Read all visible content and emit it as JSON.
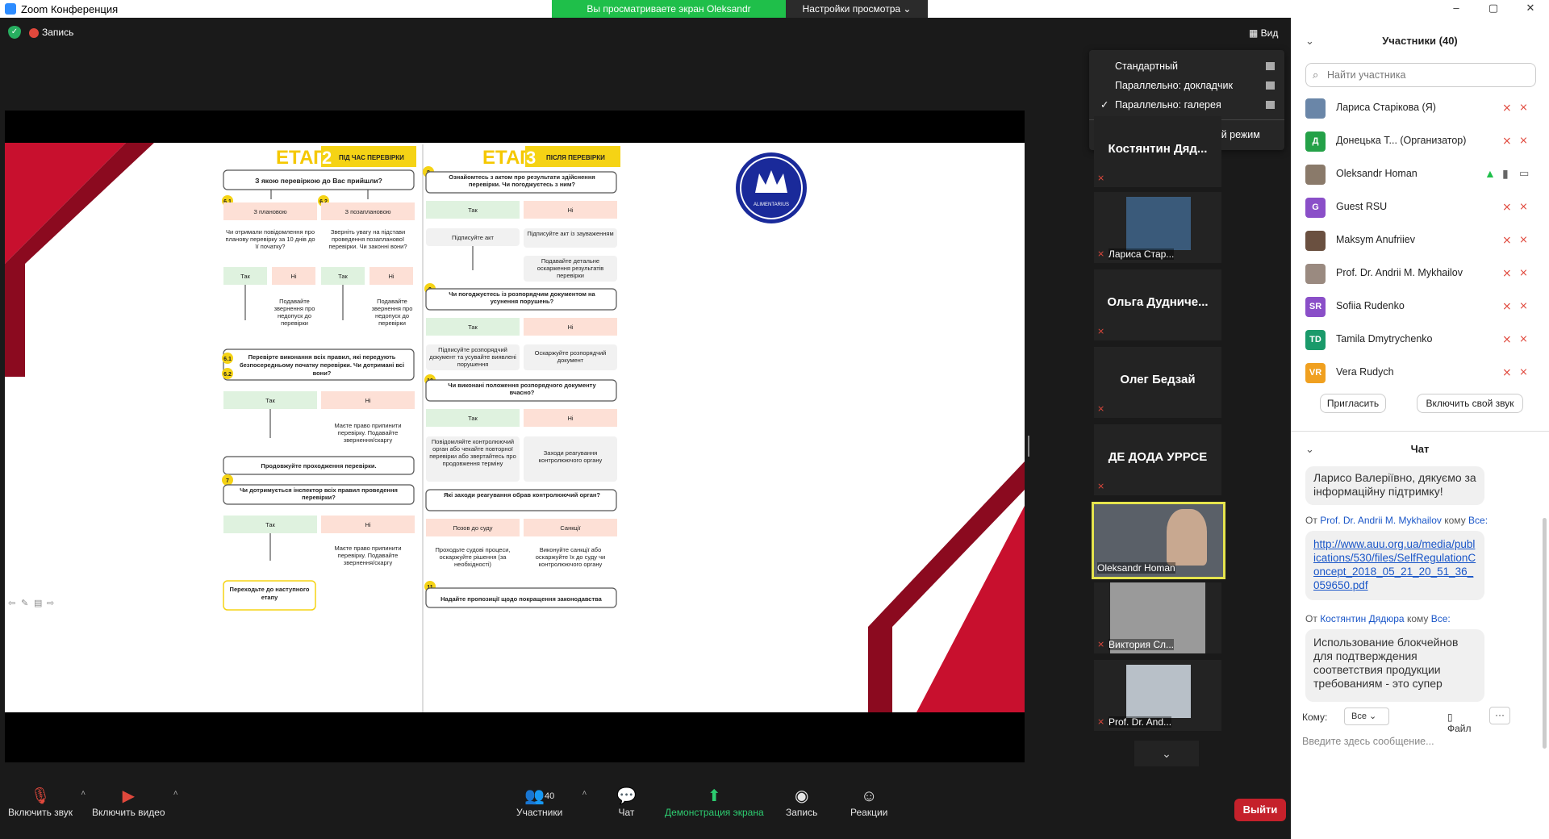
{
  "window": {
    "title": "Zoom Конференция",
    "minimize": "–",
    "maximize": "▢",
    "close": "✕"
  },
  "share_bar": {
    "viewing": "Вы просматриваете экран Oleksandr Homan",
    "view_options": "Настройки просмотра ⌄"
  },
  "top": {
    "record": "Запись",
    "view": "Вид"
  },
  "view_menu": {
    "items": [
      {
        "label": "Стандартный",
        "checked": false
      },
      {
        "label": "Параллельно: докладчик",
        "checked": false
      },
      {
        "label": "Параллельно: галерея",
        "checked": true
      }
    ],
    "check_glyph": "✓",
    "fullscreen": "Войти в полноэкранный режим"
  },
  "slide": {
    "stage2": {
      "word": "ЕТАП",
      "num": "2",
      "tag": "ПІД ЧАС ПЕРЕВІРКИ"
    },
    "stage3": {
      "word": "ЕТАП",
      "num": "3",
      "tag": "ПІСЛЯ ПЕРЕВІРКИ"
    },
    "logo_text": "ALIMENTARIUS",
    "left": {
      "q1": "З якою перевіркою до Вас прийшли?",
      "n61": "6.1",
      "n62": "6.2",
      "planned": "З плановою",
      "unplanned": "З позаплановою",
      "q_planned": "Чи отримали повідомлення про планову перевірку за 10 днів до її початку?",
      "q_unplanned": "Зверніть увагу на підстави проведення позапланової перевірки. Чи законні вони?",
      "yes": "Так",
      "no": "Ні",
      "complaint": "Подавайте звернення про недопуск до перевірки",
      "n61b": "6.1",
      "n62b": "6.2",
      "q2": "Перевірте виконання всіх правил, які передують безпосередньому початку перевірки. Чи дотримані всі вони?",
      "right_stop": "Маєте право припинити перевірку. Подавайте звернення/скаргу",
      "continue": "Продовжуйте проходження перевірки.",
      "n7": "7",
      "q3": "Чи дотримується інспектор всіх правил проведення перевірки?",
      "next": "Переходьте до наступного етапу"
    },
    "right": {
      "n8": "8",
      "q8": "Ознайомтесь з актом про результати здійснення перевірки. Чи погоджуєтесь з ним?",
      "yes": "Так",
      "no": "Ні",
      "sign": "Підписуйте акт",
      "sign_remarks": "Підписуйте акт із зауваженням",
      "appeal_detailed": "Подавайте детальне оскарження результатів перевірки",
      "n9": "9",
      "q9": "Чи погоджуєтесь із розпорядчим документом на усунення порушень?",
      "sign_doc": "Підписуйте розпорядчий документ та усувайте виявлені порушення",
      "appeal_doc": "Оскаржуйте розпорядчий документ",
      "n10": "10",
      "q10": "Чи виконані положення розпорядчого документу вчасно?",
      "notify": "Повідомляйте контролюючий орган або чекайте повторної перевірки або звертайтесь про продовження терміну",
      "measures": "Заходи реагування контролюючого органу",
      "q_measures": "Які заходи реагування обрав контролюючий орган?",
      "court": "Позов до суду",
      "sanctions": "Санкції",
      "court_text": "Проходьте судові процеси, оскаржуйте рішення (за необхідності)",
      "sanction_text": "Виконуйте санкції або оскаржуйте їх до суду чи контролюючого органу",
      "n11": "11",
      "q11": "Надайте пропозиції щодо покращення законодавства"
    }
  },
  "thumbnails": [
    {
      "name": "Костянтин  Дяд...",
      "type": "name"
    },
    {
      "label": "Лариса Стар...",
      "type": "image"
    },
    {
      "name": "Ольга  Дудниче...",
      "type": "name"
    },
    {
      "name": "Олег Бедзай",
      "type": "name"
    },
    {
      "name": "ДЕ ДОДА УРРСЕ",
      "type": "name"
    },
    {
      "label": "Oleksandr Homan",
      "type": "image",
      "active": true
    },
    {
      "label": "Виктория Сл...",
      "type": "image"
    },
    {
      "label": "Prof. Dr. And...",
      "type": "image"
    }
  ],
  "thumb_more": "⌄",
  "toolbar": {
    "unmute": "Включить звук",
    "start_video": "Включить видео",
    "participants": "Участники",
    "participants_count": "40",
    "chat": "Чат",
    "share": "Демонстрация экрана",
    "record": "Запись",
    "reactions": "Реакции",
    "leave": "Выйти"
  },
  "participants_panel": {
    "title": "Участники (40)",
    "search_placeholder": "Найти участника",
    "people": [
      {
        "name": "Лариса Старікова (Я)",
        "avatar": "",
        "color": "#6a86a8"
      },
      {
        "name": "Донецька Т...  (Организатор)",
        "avatar": "Д",
        "color": "#24a148"
      },
      {
        "name": "Oleksandr Homan",
        "avatar": "",
        "color": "#8a7a6a"
      },
      {
        "name": "Guest RSU",
        "avatar": "G",
        "color": "#8a4fc8"
      },
      {
        "name": "Maksym Anufriiev",
        "avatar": "",
        "color": "#6a5040"
      },
      {
        "name": "Prof. Dr. Andrii M. Mykhailov",
        "avatar": "",
        "color": "#9a8a80"
      },
      {
        "name": "Sofiia Rudenko",
        "avatar": "SR",
        "color": "#8a4fc8"
      },
      {
        "name": "Tamila Dmytrychenko",
        "avatar": "TD",
        "color": "#1a9a6a"
      },
      {
        "name": "Vera Rudych",
        "avatar": "VR",
        "color": "#f0a020"
      }
    ],
    "invite": "Пригласить",
    "unmute_me": "Включить свой звук"
  },
  "chat_panel": {
    "title": "Чат",
    "msg1": "Ларисо Валеріївно, дякуємо за інформаційну підтримку!",
    "from_label": "От",
    "to_label": "кому",
    "sender2": "Prof. Dr. Andrii M. Mykhailov",
    "to2": "Все:",
    "link": "http://www.auu.org.ua/media/publications/530/files/SelfRegulationConcept_2018_05_21_20_51_36_059650.pdf",
    "sender3": "Костянтин Дядюра",
    "to3": "Все:",
    "msg3": "Использование блокчейнов для  подтверждения соответствия продукции требованиям - это супер",
    "to_field": "Кому:",
    "to_value": "Все",
    "file": "Файл",
    "more": "···",
    "input_placeholder": "Введите здесь сообщение..."
  },
  "colors": {
    "green": "#1fbf4a",
    "leave_red": "#c5212b",
    "yellow": "#f5d315",
    "slide_red": "#c8102e"
  }
}
